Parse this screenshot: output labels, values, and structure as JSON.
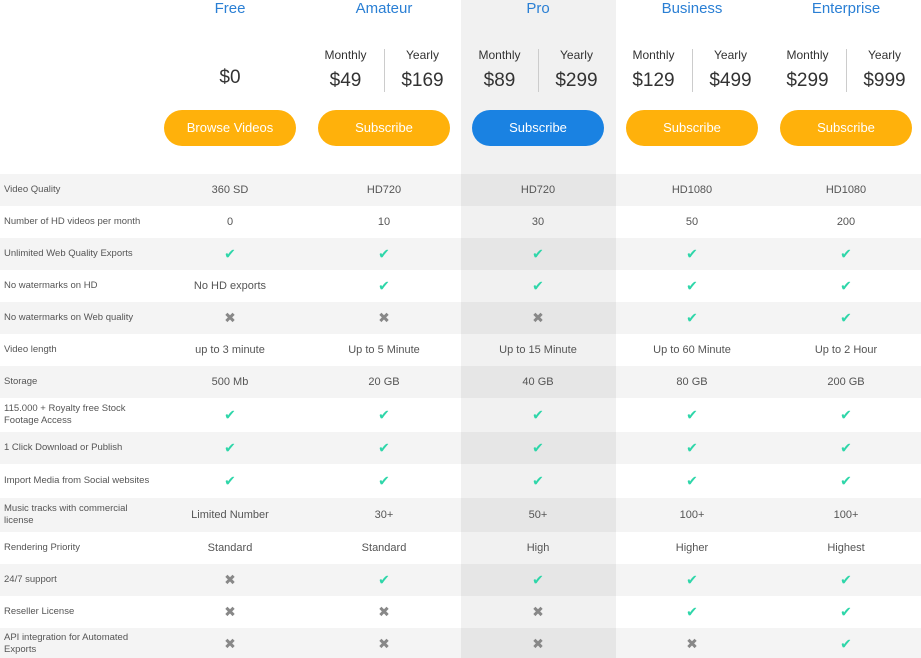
{
  "plans": [
    {
      "name": "Free",
      "price": "$0",
      "button": "Browse Videos",
      "button_style": "orange"
    },
    {
      "name": "Amateur",
      "monthly_label": "Monthly",
      "yearly_label": "Yearly",
      "monthly": "$49",
      "yearly": "$169",
      "button": "Subscribe",
      "button_style": "orange"
    },
    {
      "name": "Pro",
      "monthly_label": "Monthly",
      "yearly_label": "Yearly",
      "monthly": "$89",
      "yearly": "$299",
      "button": "Subscribe",
      "button_style": "blue",
      "highlighted": true
    },
    {
      "name": "Business",
      "monthly_label": "Monthly",
      "yearly_label": "Yearly",
      "monthly": "$129",
      "yearly": "$499",
      "button": "Subscribe",
      "button_style": "orange"
    },
    {
      "name": "Enterprise",
      "monthly_label": "Monthly",
      "yearly_label": "Yearly",
      "monthly": "$299",
      "yearly": "$999",
      "button": "Subscribe",
      "button_style": "orange"
    }
  ],
  "features": [
    {
      "label": "Video Quality",
      "values": [
        "360 SD",
        "HD720",
        "HD720",
        "HD1080",
        "HD1080"
      ]
    },
    {
      "label": "Number of HD videos per month",
      "values": [
        "0",
        "10",
        "30",
        "50",
        "200"
      ]
    },
    {
      "label": "Unlimited Web Quality Exports",
      "values": [
        true,
        true,
        true,
        true,
        true
      ]
    },
    {
      "label": "No watermarks on HD",
      "values": [
        "No HD exports",
        true,
        true,
        true,
        true
      ]
    },
    {
      "label": "No watermarks on Web quality",
      "values": [
        false,
        false,
        false,
        true,
        true
      ]
    },
    {
      "label": "Video length",
      "values": [
        "up to 3 minute",
        "Up to 5 Minute",
        "Up to 15 Minute",
        "Up to 60 Minute",
        "Up to 2 Hour"
      ]
    },
    {
      "label": "Storage",
      "values": [
        "500 Mb",
        "20 GB",
        "40 GB",
        "80 GB",
        "200 GB"
      ]
    },
    {
      "label": "115.000 + Royalty free Stock Footage Access",
      "values": [
        true,
        true,
        true,
        true,
        true
      ]
    },
    {
      "label": "1 Click Download or Publish",
      "values": [
        true,
        true,
        true,
        true,
        true
      ]
    },
    {
      "label": "Import Media from Social websites",
      "values": [
        true,
        true,
        true,
        true,
        true
      ]
    },
    {
      "label": "Music tracks with commercial license",
      "values": [
        "Limited Number",
        "30+",
        "50+",
        "100+",
        "100+"
      ]
    },
    {
      "label": "Rendering Priority",
      "values": [
        "Standard",
        "Standard",
        "High",
        "Higher",
        "Highest"
      ]
    },
    {
      "label": "24/7 support",
      "values": [
        false,
        true,
        true,
        true,
        true
      ]
    },
    {
      "label": "Reseller License",
      "values": [
        false,
        false,
        false,
        true,
        true
      ]
    },
    {
      "label": "API integration for Automated Exports",
      "values": [
        false,
        false,
        false,
        false,
        true
      ]
    }
  ],
  "icons": {
    "check": "check-icon",
    "cross": "cross-icon"
  },
  "colors": {
    "accent_blue": "#2a7fd4",
    "button_orange": "#ffb10b",
    "button_blue": "#1a82e2",
    "check_green": "#2ed6a9",
    "cross_gray": "#888888"
  }
}
